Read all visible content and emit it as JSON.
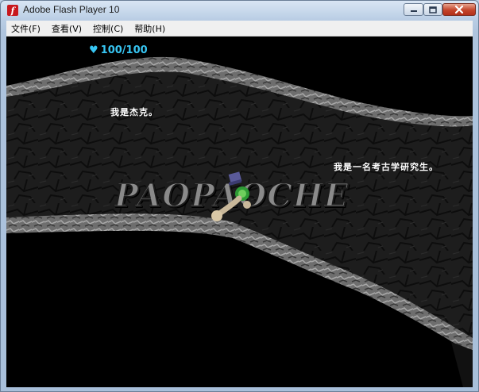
{
  "window": {
    "title": "Adobe Flash Player 10",
    "app_icon_glyph": "f"
  },
  "menu": {
    "items": [
      {
        "label": "文件(F)"
      },
      {
        "label": "查看(V)"
      },
      {
        "label": "控制(C)"
      },
      {
        "label": "帮助(H)"
      }
    ]
  },
  "game": {
    "health": "100/100",
    "health_icon": "heart-icon",
    "health_color": "#37c5f2",
    "dialogue_1": "我是杰克。",
    "dialogue_2": "我是一名考古学研究生。",
    "watermark": "PAOPAOCHE"
  }
}
